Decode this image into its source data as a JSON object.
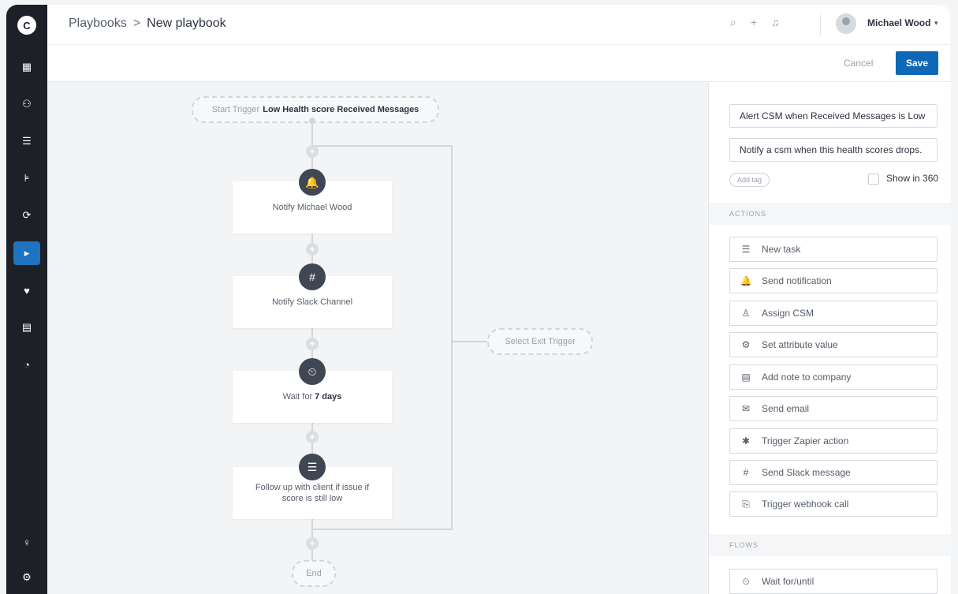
{
  "header": {
    "breadcrumb_root": "Playbooks",
    "breadcrumb_sep": ">",
    "breadcrumb_current": "New playbook",
    "user_name": "Michael Wood",
    "caret": "▾",
    "icons": [
      "search-icon",
      "plus-icon",
      "bell-icon"
    ]
  },
  "toolbar": {
    "cancel_label": "Cancel",
    "save_label": "Save"
  },
  "sidebar": {
    "logo": "C",
    "items": [
      {
        "name": "dashboard-icon",
        "glyph": "▦"
      },
      {
        "name": "users-icon",
        "glyph": "⚇"
      },
      {
        "name": "tasks-icon",
        "glyph": "☰"
      },
      {
        "name": "hierarchy-icon",
        "glyph": "⊧"
      },
      {
        "name": "sync-icon",
        "glyph": "⟳"
      },
      {
        "name": "playbooks-icon",
        "glyph": "▸"
      },
      {
        "name": "health-icon",
        "glyph": "♥"
      },
      {
        "name": "calculator-icon",
        "glyph": "▤"
      },
      {
        "name": "speed-icon",
        "glyph": "◔"
      },
      {
        "name": "lightbulb-icon",
        "glyph": "♀"
      },
      {
        "name": "settings-icon",
        "glyph": "⚙"
      }
    ]
  },
  "flow": {
    "start_label": "Start Trigger",
    "start_value": "Low Health score Received Messages",
    "exit_label": "Select Exit Trigger",
    "end_label": "End",
    "plus_glyph": "+",
    "steps": [
      {
        "icon": "bell-icon",
        "glyph": "🔔",
        "text": "Notify Michael Wood",
        "bold": ""
      },
      {
        "icon": "slack-icon",
        "glyph": "#",
        "text": "Notify Slack Channel",
        "bold": ""
      },
      {
        "icon": "timer-icon",
        "glyph": "⏲",
        "text": "Wait for",
        "bold": "7 days"
      },
      {
        "icon": "checklist-icon",
        "glyph": "☰",
        "text": "Follow up with client if issue if score is still low",
        "bold": ""
      }
    ]
  },
  "panel": {
    "name_value": "Alert CSM when Received Messages is Low",
    "desc_value": "Notify a csm when this health scores drops.",
    "add_tag": "Add tag",
    "show_360": "Show in 360",
    "actions_header": "ACTIONS",
    "flows_header": "FLOWS",
    "actions": [
      {
        "icon": "task-icon",
        "glyph": "☰",
        "label": "New task"
      },
      {
        "icon": "bell-icon",
        "glyph": "🔔",
        "label": "Send notification"
      },
      {
        "icon": "assign-user-icon",
        "glyph": "♙",
        "label": "Assign CSM"
      },
      {
        "icon": "gears-icon",
        "glyph": "⚙",
        "label": "Set attribute value"
      },
      {
        "icon": "note-icon",
        "glyph": "▤",
        "label": "Add note to company"
      },
      {
        "icon": "mail-icon",
        "glyph": "✉",
        "label": "Send email"
      },
      {
        "icon": "zapier-icon",
        "glyph": "✱",
        "label": "Trigger Zapier action"
      },
      {
        "icon": "slack-icon",
        "glyph": "#",
        "label": "Send Slack message"
      },
      {
        "icon": "webhook-icon",
        "glyph": "⎘",
        "label": "Trigger webhook call"
      }
    ],
    "flows": [
      {
        "icon": "timer-icon",
        "glyph": "⏲",
        "label": "Wait for/until"
      }
    ]
  },
  "colors": {
    "accent": "#0d68b5",
    "rail": "#1d2127",
    "active_rail": "#1e72bf",
    "node": "#404653"
  }
}
